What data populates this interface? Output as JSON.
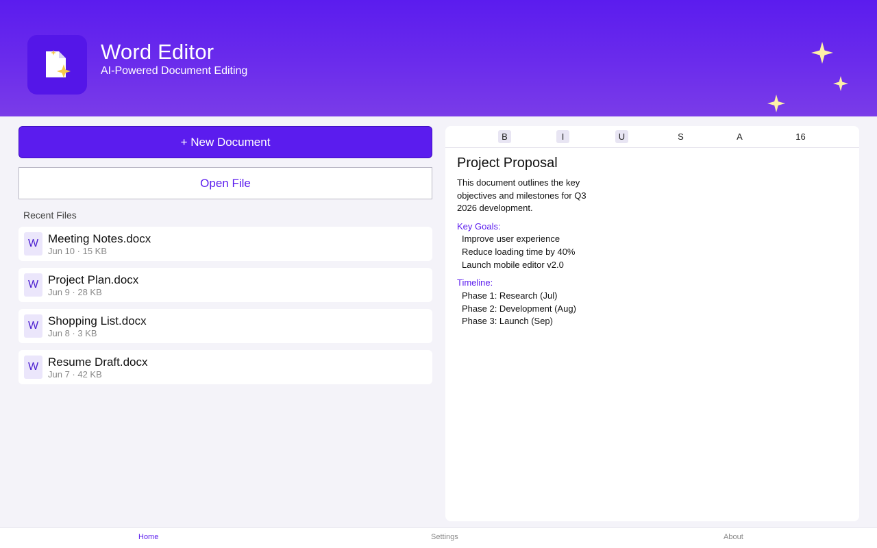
{
  "header": {
    "title": "Word Editor",
    "subtitle": "AI-Powered Document Editing",
    "icon": "document-sparkle-icon"
  },
  "actions": {
    "new_document": "+ New Document",
    "open_file": "Open File"
  },
  "recent": {
    "label": "Recent Files",
    "files": [
      {
        "icon": "W",
        "name": "Meeting Notes.docx",
        "meta": "Jun 10 · 15 KB"
      },
      {
        "icon": "W",
        "name": "Project Plan.docx",
        "meta": "Jun 9 · 28 KB"
      },
      {
        "icon": "W",
        "name": "Shopping List.docx",
        "meta": "Jun 8 · 3 KB"
      },
      {
        "icon": "W",
        "name": "Resume Draft.docx",
        "meta": "Jun 7 · 42 KB"
      }
    ]
  },
  "toolbar": {
    "bold": "B",
    "italic": "I",
    "underline": "U",
    "strike": "S",
    "color": "A",
    "font_size": "16"
  },
  "document": {
    "title": "Project Proposal",
    "intro": "This document outlines the key objectives and milestones for Q3 2026 development.",
    "sections": [
      {
        "heading": "Key Goals:",
        "items": [
          "Improve user experience",
          "Reduce loading time by 40%",
          "Launch mobile editor v2.0"
        ]
      },
      {
        "heading": "Timeline:",
        "items": [
          "Phase 1: Research (Jul)",
          "Phase 2: Development (Aug)",
          "Phase 3: Launch (Sep)"
        ]
      }
    ]
  },
  "nav": {
    "home": "Home",
    "settings": "Settings",
    "about": "About"
  },
  "colors": {
    "accent": "#5b1cee",
    "header_gradient_end": "#7a3ce8",
    "background": "#f4f3f9",
    "sparkle": "#fdf1a8"
  }
}
